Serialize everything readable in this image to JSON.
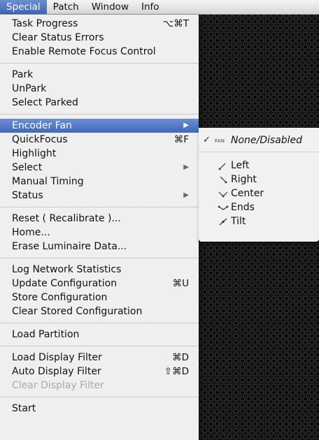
{
  "menubar": {
    "items": [
      "Special",
      "Patch",
      "Window",
      "Info"
    ]
  },
  "menu": {
    "groups": [
      [
        {
          "label": "Task Progress",
          "shortcut": "⌥⌘T"
        },
        {
          "label": "Clear Status Errors"
        },
        {
          "label": "Enable Remote Focus Control"
        }
      ],
      [
        {
          "label": "Park"
        },
        {
          "label": "UnPark"
        },
        {
          "label": "Select Parked"
        }
      ],
      [
        {
          "label": "Encoder Fan",
          "submenu": true,
          "highlighted": true
        },
        {
          "label": "QuickFocus",
          "shortcut": "⌘F"
        },
        {
          "label": "Highlight"
        },
        {
          "label": "Select",
          "submenu": true
        },
        {
          "label": "Manual Timing"
        },
        {
          "label": "Status",
          "submenu": true
        }
      ],
      [
        {
          "label": "Reset ( Recalibrate )..."
        },
        {
          "label": "Home..."
        },
        {
          "label": "Erase Luminaire Data..."
        }
      ],
      [
        {
          "label": "Log Network Statistics"
        },
        {
          "label": "Update Configuration",
          "shortcut": "⌘U"
        },
        {
          "label": "Store Configuration"
        },
        {
          "label": "Clear Stored Configuration"
        }
      ],
      [
        {
          "label": "Load Partition"
        }
      ],
      [
        {
          "label": "Load Display Filter",
          "shortcut": "⌘D"
        },
        {
          "label": "Auto Display Filter",
          "shortcut": "⇧⌘D"
        },
        {
          "label": "Clear Display Filter",
          "disabled": true
        }
      ],
      [
        {
          "label": "Start"
        }
      ]
    ]
  },
  "submenu": {
    "items": [
      {
        "label": "None/Disabled",
        "checked": true,
        "icon_text": "FAN",
        "icon": "fan-text-icon"
      },
      {
        "label": "Left",
        "icon": "fan-left-icon"
      },
      {
        "label": "Right",
        "icon": "fan-right-icon"
      },
      {
        "label": "Center",
        "icon": "fan-center-icon"
      },
      {
        "label": "Ends",
        "icon": "fan-ends-icon"
      },
      {
        "label": "Tilt",
        "icon": "fan-tilt-icon"
      }
    ]
  },
  "glyphs": {
    "checkmark": "✓",
    "submenu_arrow": "▶"
  }
}
